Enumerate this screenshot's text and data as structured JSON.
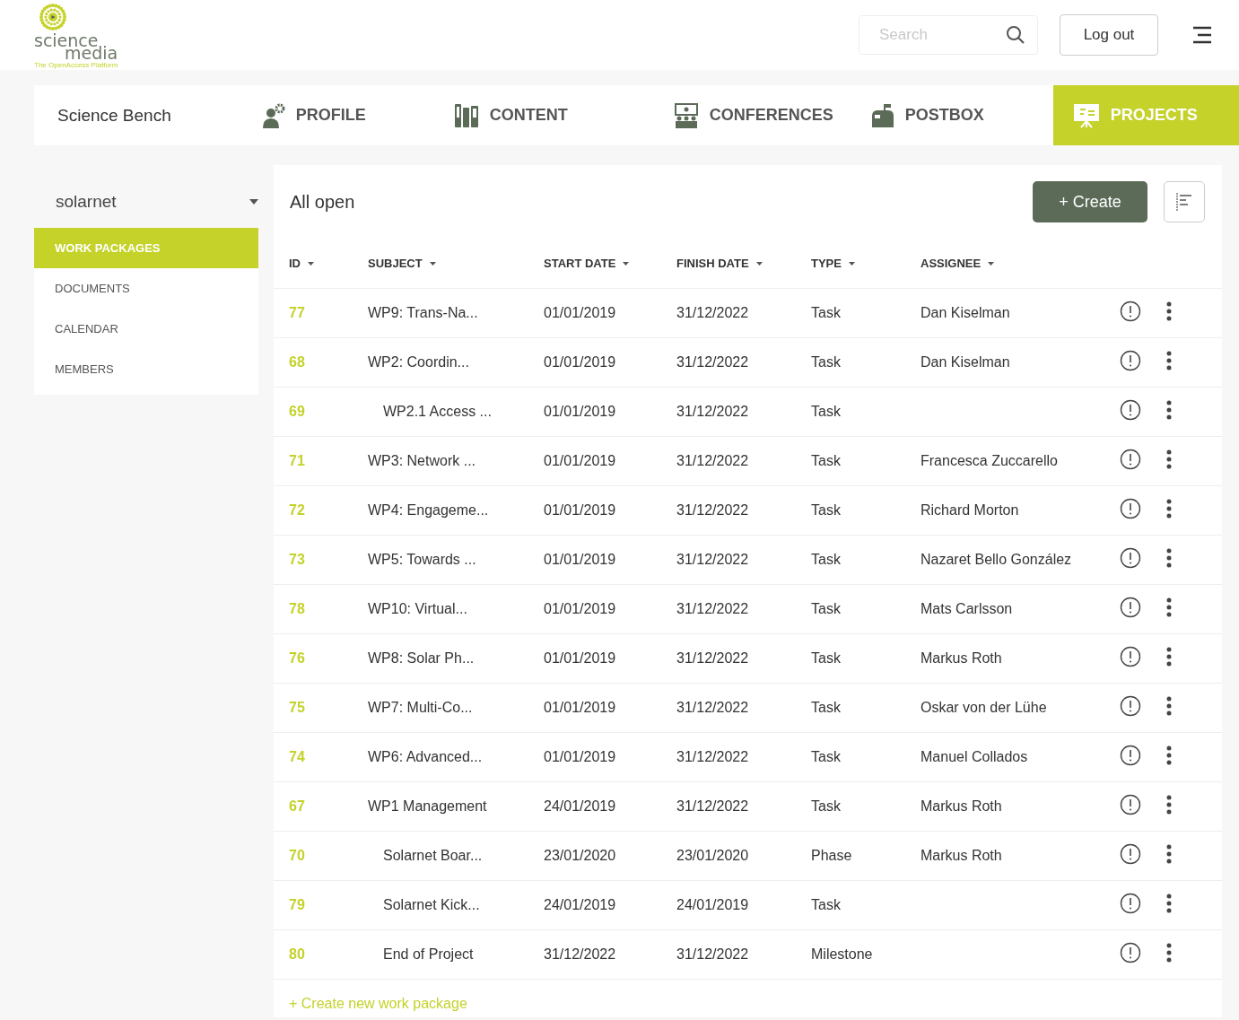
{
  "header": {
    "logo": {
      "word_1": "science",
      "word_2": "media",
      "tagline": "The OpenAccess Platform"
    },
    "search": {
      "placeholder": "Search"
    },
    "logout": "Log out"
  },
  "nav": {
    "title": "Science Bench",
    "tabs": [
      {
        "label": "PROFILE",
        "selected": false
      },
      {
        "label": "CONTENT",
        "selected": false
      },
      {
        "label": "CONFERENCES",
        "selected": false
      },
      {
        "label": "POSTBOX",
        "selected": false
      },
      {
        "label": "PROJECTS",
        "selected": true
      }
    ]
  },
  "sidebar": {
    "project": "solarnet",
    "items": [
      {
        "label": "WORK PACKAGES",
        "selected": true
      },
      {
        "label": "DOCUMENTS",
        "selected": false
      },
      {
        "label": "CALENDAR",
        "selected": false
      },
      {
        "label": "MEMBERS",
        "selected": false
      }
    ]
  },
  "table": {
    "title": "All open",
    "create": "+ Create",
    "columns": [
      "ID",
      "SUBJECT",
      "START DATE",
      "FINISH DATE",
      "TYPE",
      "ASSIGNEE"
    ],
    "rows": [
      {
        "id": "77",
        "subject": "WP9: Trans-Na...",
        "start": "01/01/2019",
        "finish": "31/12/2022",
        "type": "Task",
        "assignee": "Dan Kiselman"
      },
      {
        "id": "68",
        "subject": "WP2: Coordin...",
        "start": "01/01/2019",
        "finish": "31/12/2022",
        "type": "Task",
        "assignee": "Dan Kiselman",
        "children": [
          {
            "id": "69",
            "subject": "WP2.1 Access ...",
            "start": "01/01/2019",
            "finish": "31/12/2022",
            "type": "Task"
          }
        ]
      },
      {
        "id": "71",
        "subject": "WP3: Network ...",
        "start": "01/01/2019",
        "finish": "31/12/2022",
        "type": "Task",
        "assignee": "Francesca Zuccarello"
      },
      {
        "id": "72",
        "subject": "WP4: Engageme...",
        "start": "01/01/2019",
        "finish": "31/12/2022",
        "type": "Task",
        "assignee": "Richard Morton"
      },
      {
        "id": "73",
        "subject": "WP5: Towards ...",
        "start": "01/01/2019",
        "finish": "31/12/2022",
        "type": "Task",
        "assignee": "Nazaret Bello González"
      },
      {
        "id": "78",
        "subject": "WP10: Virtual...",
        "start": "01/01/2019",
        "finish": "31/12/2022",
        "type": "Task",
        "assignee": "Mats Carlsson"
      },
      {
        "id": "76",
        "subject": "WP8: Solar Ph...",
        "start": "01/01/2019",
        "finish": "31/12/2022",
        "type": "Task",
        "assignee": "Markus Roth"
      },
      {
        "id": "75",
        "subject": "WP7: Multi-Co...",
        "start": "01/01/2019",
        "finish": "31/12/2022",
        "type": "Task",
        "assignee": "Oskar von der Lühe"
      },
      {
        "id": "74",
        "subject": "WP6: Advanced...",
        "start": "01/01/2019",
        "finish": "31/12/2022",
        "type": "Task",
        "assignee": "Manuel Collados"
      },
      {
        "id": "67",
        "subject": "WP1 Management",
        "start": "24/01/2019",
        "finish": "31/12/2022",
        "type": "Task",
        "assignee": "Markus Roth",
        "children": [
          {
            "id": "70",
            "subject": "Solarnet Boar...",
            "start": "23/01/2020",
            "finish": "23/01/2020",
            "type": "Phase",
            "assignee": "Markus Roth"
          },
          {
            "id": "79",
            "subject": "Solarnet Kick...",
            "start": "24/01/2019",
            "finish": "24/01/2019",
            "type": "Task"
          },
          {
            "id": "80",
            "subject": "End of Project",
            "start": "31/12/2022",
            "finish": "31/12/2022",
            "type": "Milestone"
          }
        ]
      }
    ],
    "footer_link": "+ Create new work package"
  }
}
